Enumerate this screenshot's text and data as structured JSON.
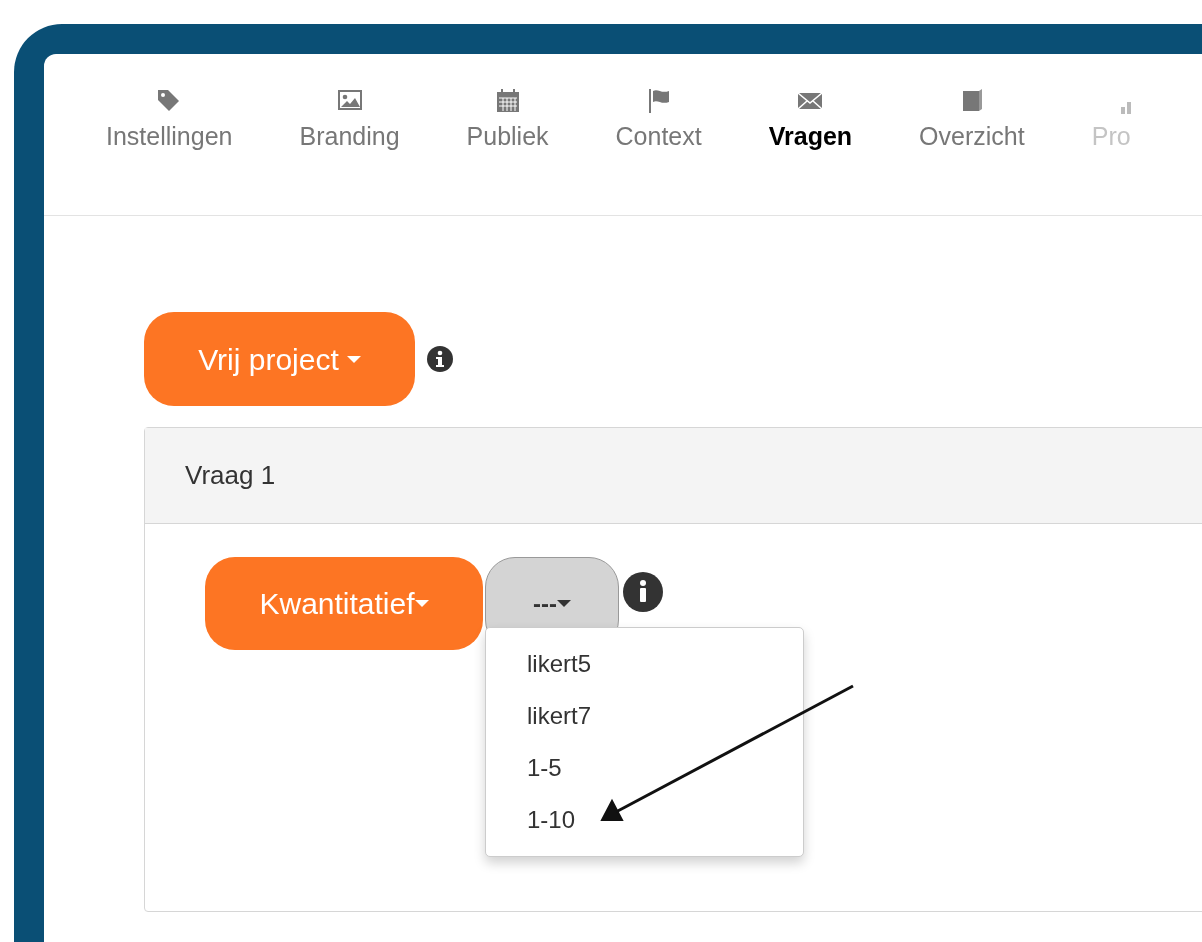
{
  "tabs": [
    {
      "label": "Instellingen",
      "selected": false,
      "disabled": false
    },
    {
      "label": "Branding",
      "selected": false,
      "disabled": false
    },
    {
      "label": "Publiek",
      "selected": false,
      "disabled": false
    },
    {
      "label": "Context",
      "selected": false,
      "disabled": false
    },
    {
      "label": "Vragen",
      "selected": true,
      "disabled": false
    },
    {
      "label": "Overzicht",
      "selected": false,
      "disabled": false
    },
    {
      "label": "Pro",
      "selected": false,
      "disabled": true
    }
  ],
  "project_button": {
    "label": "Vrij project"
  },
  "question": {
    "title": "Vraag 1",
    "type_button": {
      "label": "Kwantitatief"
    },
    "scale_button": {
      "label": "---"
    },
    "scale_menu": {
      "expanded": true,
      "items": [
        "likert5",
        "likert7",
        "1-5",
        "1-10"
      ]
    }
  }
}
